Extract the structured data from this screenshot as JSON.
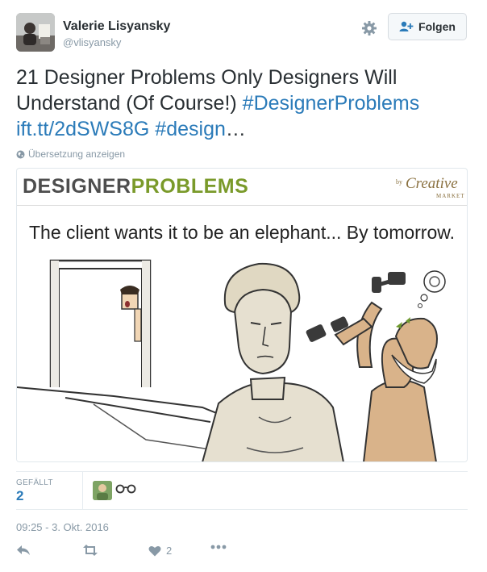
{
  "user": {
    "name": "Valerie Lisyansky",
    "handle": "@vlisyansky"
  },
  "follow_button": {
    "label": "Folgen"
  },
  "tweet": {
    "text": "21 Designer Problems Only Designers Will Understand (Of Course!)",
    "hashtag1": "#DesignerProblems",
    "link": "ift.tt/2dSWS8G",
    "hashtag2": "#design",
    "ellipsis": "…"
  },
  "translate_label": "Übersetzung anzeigen",
  "card": {
    "brand_part1": "DESIGNER",
    "brand_part2": "PROBLEMS",
    "partner_by": "by",
    "partner_name": "Creative",
    "partner_sub": "MARKET",
    "caption": "The client wants it to be an elephant... By tomorrow."
  },
  "stats": {
    "likes_label": "GEFÄLLT",
    "likes_count": "2"
  },
  "timestamp": "09:25 - 3. Okt. 2016",
  "actions": {
    "like_count": "2"
  },
  "colors": {
    "link": "#2b7bb9",
    "muted": "#8899a6",
    "brand_green": "#7a9a2a"
  }
}
